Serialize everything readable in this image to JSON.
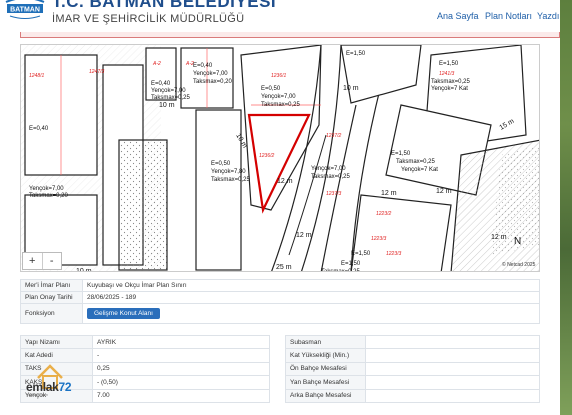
{
  "header": {
    "city_title": "T.C. BATMAN BELEDİYESİ",
    "department": "İMAR VE ŞEHİRCİLİK MÜDÜRLÜĞÜ",
    "logo_text": "BATMAN",
    "nav": [
      "Ana Sayfa",
      "Plan Notları",
      "Yazdır"
    ]
  },
  "map": {
    "parcel_labels": [
      "1248/1",
      "1247/3",
      "A-2",
      "A-2",
      "1236/1",
      "1241/3",
      "1236/2",
      "1237/2",
      "1237/3",
      "1223/2",
      "1223/3",
      "1223/3"
    ],
    "zone_texts": [
      "E=0,40",
      "E=0,40",
      "Yençok=7,00",
      "Yençok=7,00",
      "Taksmax=0,20",
      "Taksmax=0,20",
      "E=0,50",
      "Yençok=7,00",
      "Taksmax=0,25",
      "E=1,50",
      "Yençok=7 Kat",
      "Taksmax=0,25",
      "E=1,50",
      "Taksmax=0,25",
      "Yençok=7 Kat",
      "E=1,50",
      "Yençok=7,00",
      "Taksmax=0,25",
      "E=0,40",
      "Yençok=7,00",
      "Taksmax=0,25",
      "E=0,50",
      "Yençok=7,80",
      "Taksmax=0,25",
      "E=1,50",
      "Taksmax=0,25",
      "E=1,50"
    ],
    "road_widths": [
      "15 m",
      "10 m",
      "10 m",
      "10 m",
      "12 m",
      "12 m",
      "12 m",
      "12 m",
      "12 m",
      "10 m",
      "25 m"
    ],
    "zoom_in": "+",
    "zoom_out": "-",
    "attribution": "© Netcad 2025",
    "north": "N",
    "colors": {
      "parcel_line": "#ff6666",
      "block_line": "#222222",
      "highlight": "#d40000",
      "hatch": "#999999"
    }
  },
  "info": {
    "rows": [
      {
        "label": "Mer'i İmar Planı",
        "value": "Kuyubaşı ve Okçu İmar Plan Sınırı"
      },
      {
        "label": "Plan Onay Tarihi",
        "value": "28/06/2025 - 189"
      },
      {
        "label": "Fonksiyon",
        "button": "Gelişme Konut Alanı"
      }
    ]
  },
  "left_table": [
    {
      "label": "Yapı Nizamı",
      "value": "AYRIK"
    },
    {
      "label": "Kat Adedi",
      "value": "-"
    },
    {
      "label": "TAKS",
      "value": "0,25"
    },
    {
      "label": "KAKS",
      "value": "- (0,50)"
    },
    {
      "label": "Yençok",
      "value": "7.00"
    }
  ],
  "right_table": [
    {
      "label": "Subasman",
      "value": ""
    },
    {
      "label": "Kat Yüksekliği (Min.)",
      "value": ""
    },
    {
      "label": "Ön Bahçe Mesafesi",
      "value": ""
    },
    {
      "label": "Yan Bahçe Mesafesi",
      "value": ""
    },
    {
      "label": "Arka Bahçe Mesafesi",
      "value": ""
    }
  ],
  "watermark": {
    "brand": "emlak",
    "number": "72",
    "sub": "emlak72.com"
  }
}
